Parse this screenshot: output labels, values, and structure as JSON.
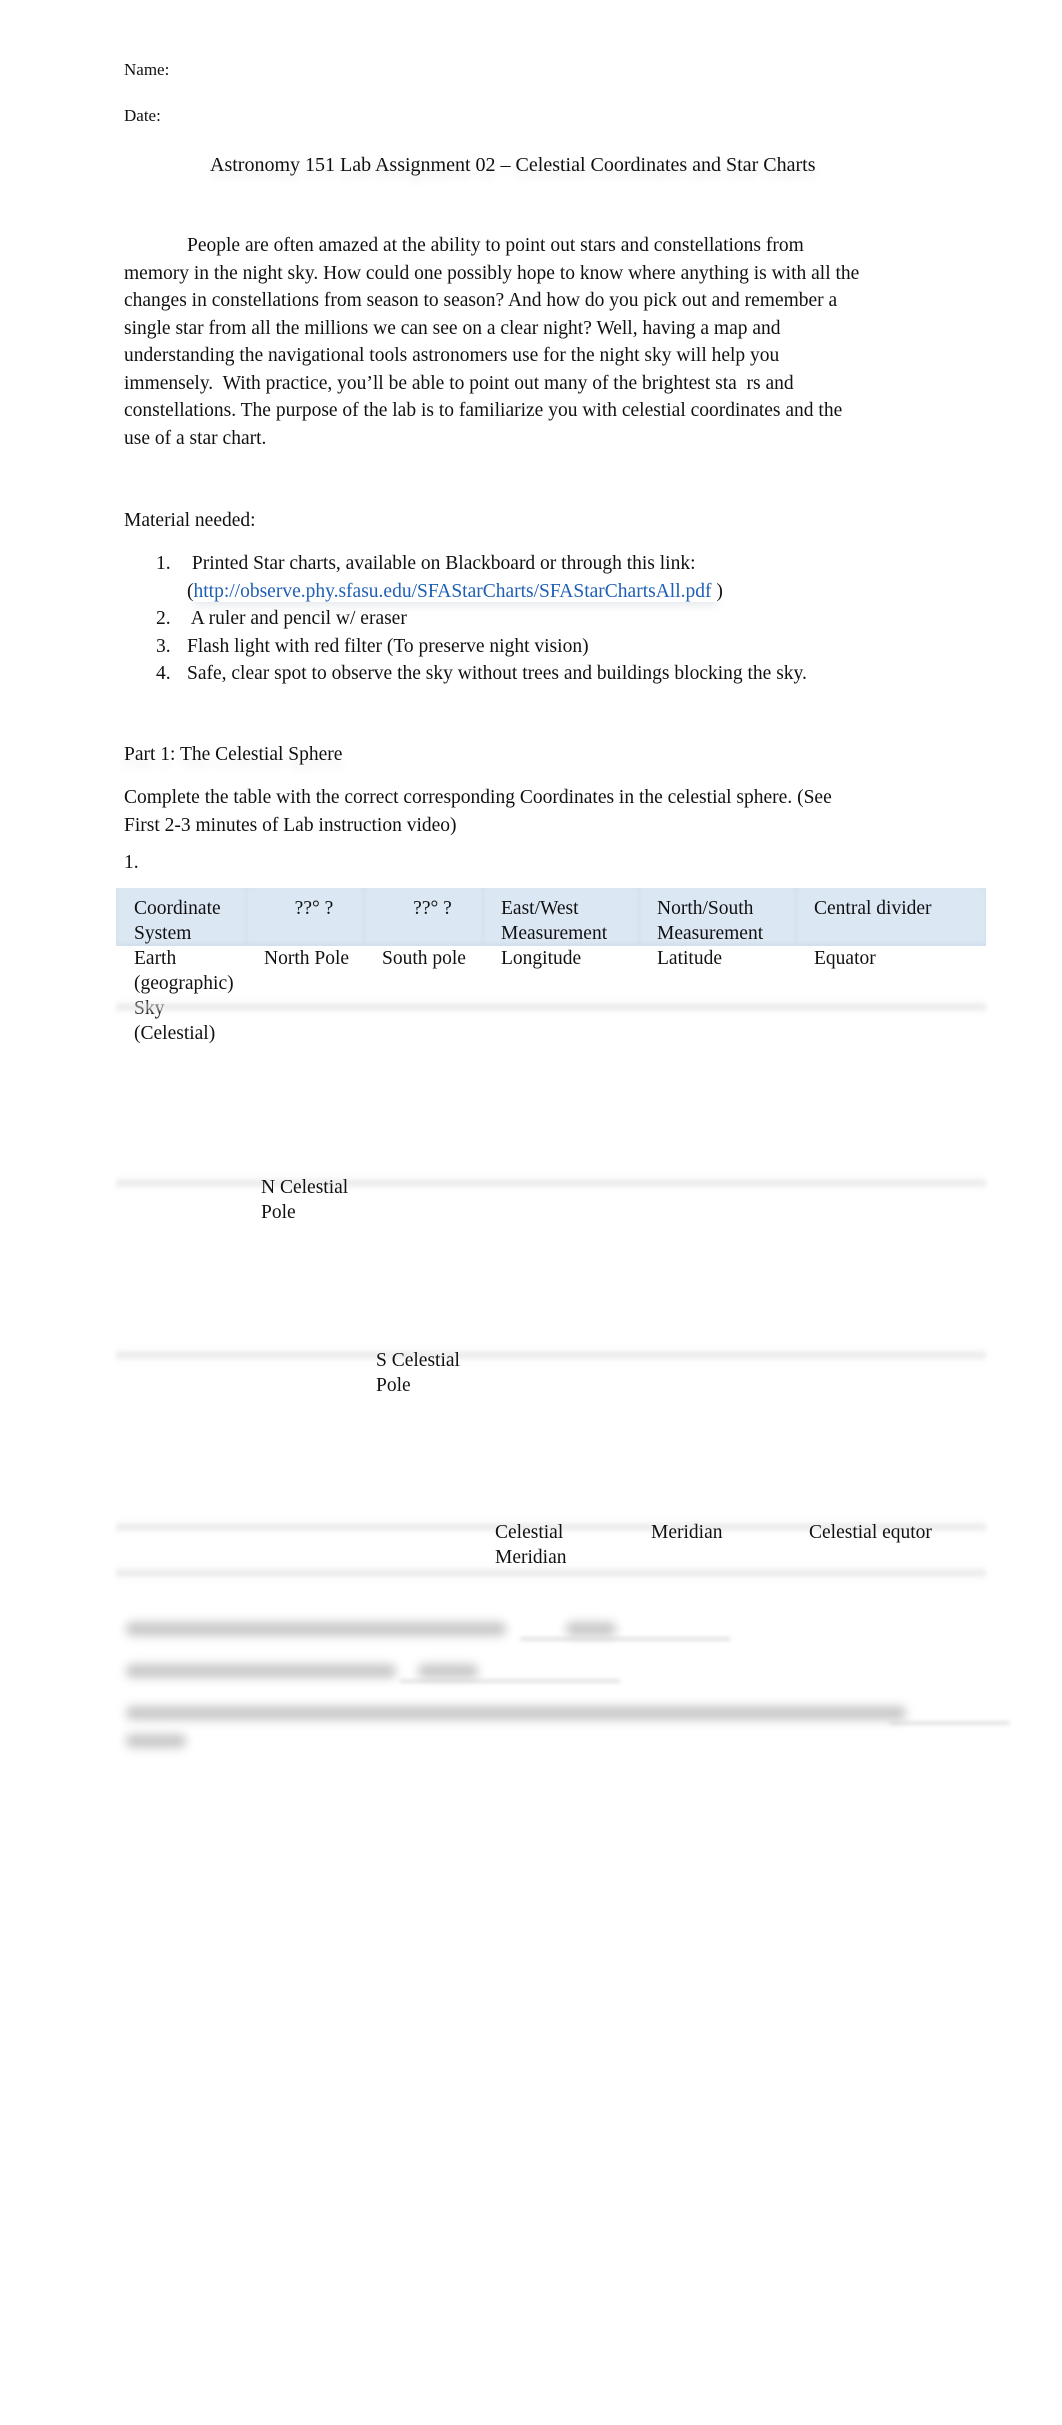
{
  "header": {
    "name_label": "Name:",
    "date_label": "Date:",
    "title": "Astronomy 151 Lab Assignment 02 – Celestial Coordinates and Star Charts"
  },
  "intro": {
    "lines": [
      "People are often amazed at the ability to point out stars and constellations from",
      "memory in the night sky. How could one possibly hope to know where anything is with all the",
      "changes in constellations from season to season? And how do you pick out and remember a",
      "single star from all the millions we can see on a clear night? Well, having a map and",
      "understanding the navigational tools astronomers use for the night sky will help you",
      "immensely.  With practice, you’ll be able to point out many of the brightest sta  rs and",
      "constellations. The purpose of the lab is to familiarize you with celestial coordinates and the",
      "use of a star chart."
    ]
  },
  "materials": {
    "heading": "Material needed:",
    "items": [
      {
        "num": "1.",
        "text": " Printed Star charts, available on Blackboard or through this link:",
        "link_prefix": "(",
        "link": "http://observe.phy.sfasu.edu/SFAStarCharts/SFAStarChartsAll.pdf",
        "link_suffix": " )"
      },
      {
        "num": "2.",
        "text": " A ruler and pencil w/ eraser"
      },
      {
        "num": "3.",
        "text": "Flash light with red filter (To preserve night vision)"
      },
      {
        "num": "4.",
        "text": "Safe, clear spot to observe the sky without trees and buildings blocking the sky."
      }
    ]
  },
  "part1": {
    "heading": "Part 1: The Celestial Sphere",
    "instructions_line1": "Complete the table with the correct corresponding Coordinates in the celestial sphere. (See",
    "instructions_line2": "First 2-3 minutes of Lab instruction video)",
    "question_number": "1."
  },
  "table": {
    "headers": [
      "Coordinate System",
      "??° ?",
      "??° ?",
      "East/West Measurement",
      "North/South Measurement",
      "Central divider"
    ],
    "rows": [
      [
        "Earth (geographic)",
        "North Pole",
        "South pole",
        "Longitude",
        "Latitude",
        "Equator"
      ],
      [
        "Sky (Celestial)",
        "",
        "",
        "",
        "",
        ""
      ]
    ],
    "answers": {
      "north_pole_sky": "N Celestial Pole",
      "south_pole_sky": "S Celestial Pole",
      "east_west_sky": "Celestial Meridian",
      "north_south_sky": "Meridian",
      "central_divider_sky": "Celestial equtor"
    }
  },
  "blurred_questions": {
    "note": "obscured"
  }
}
